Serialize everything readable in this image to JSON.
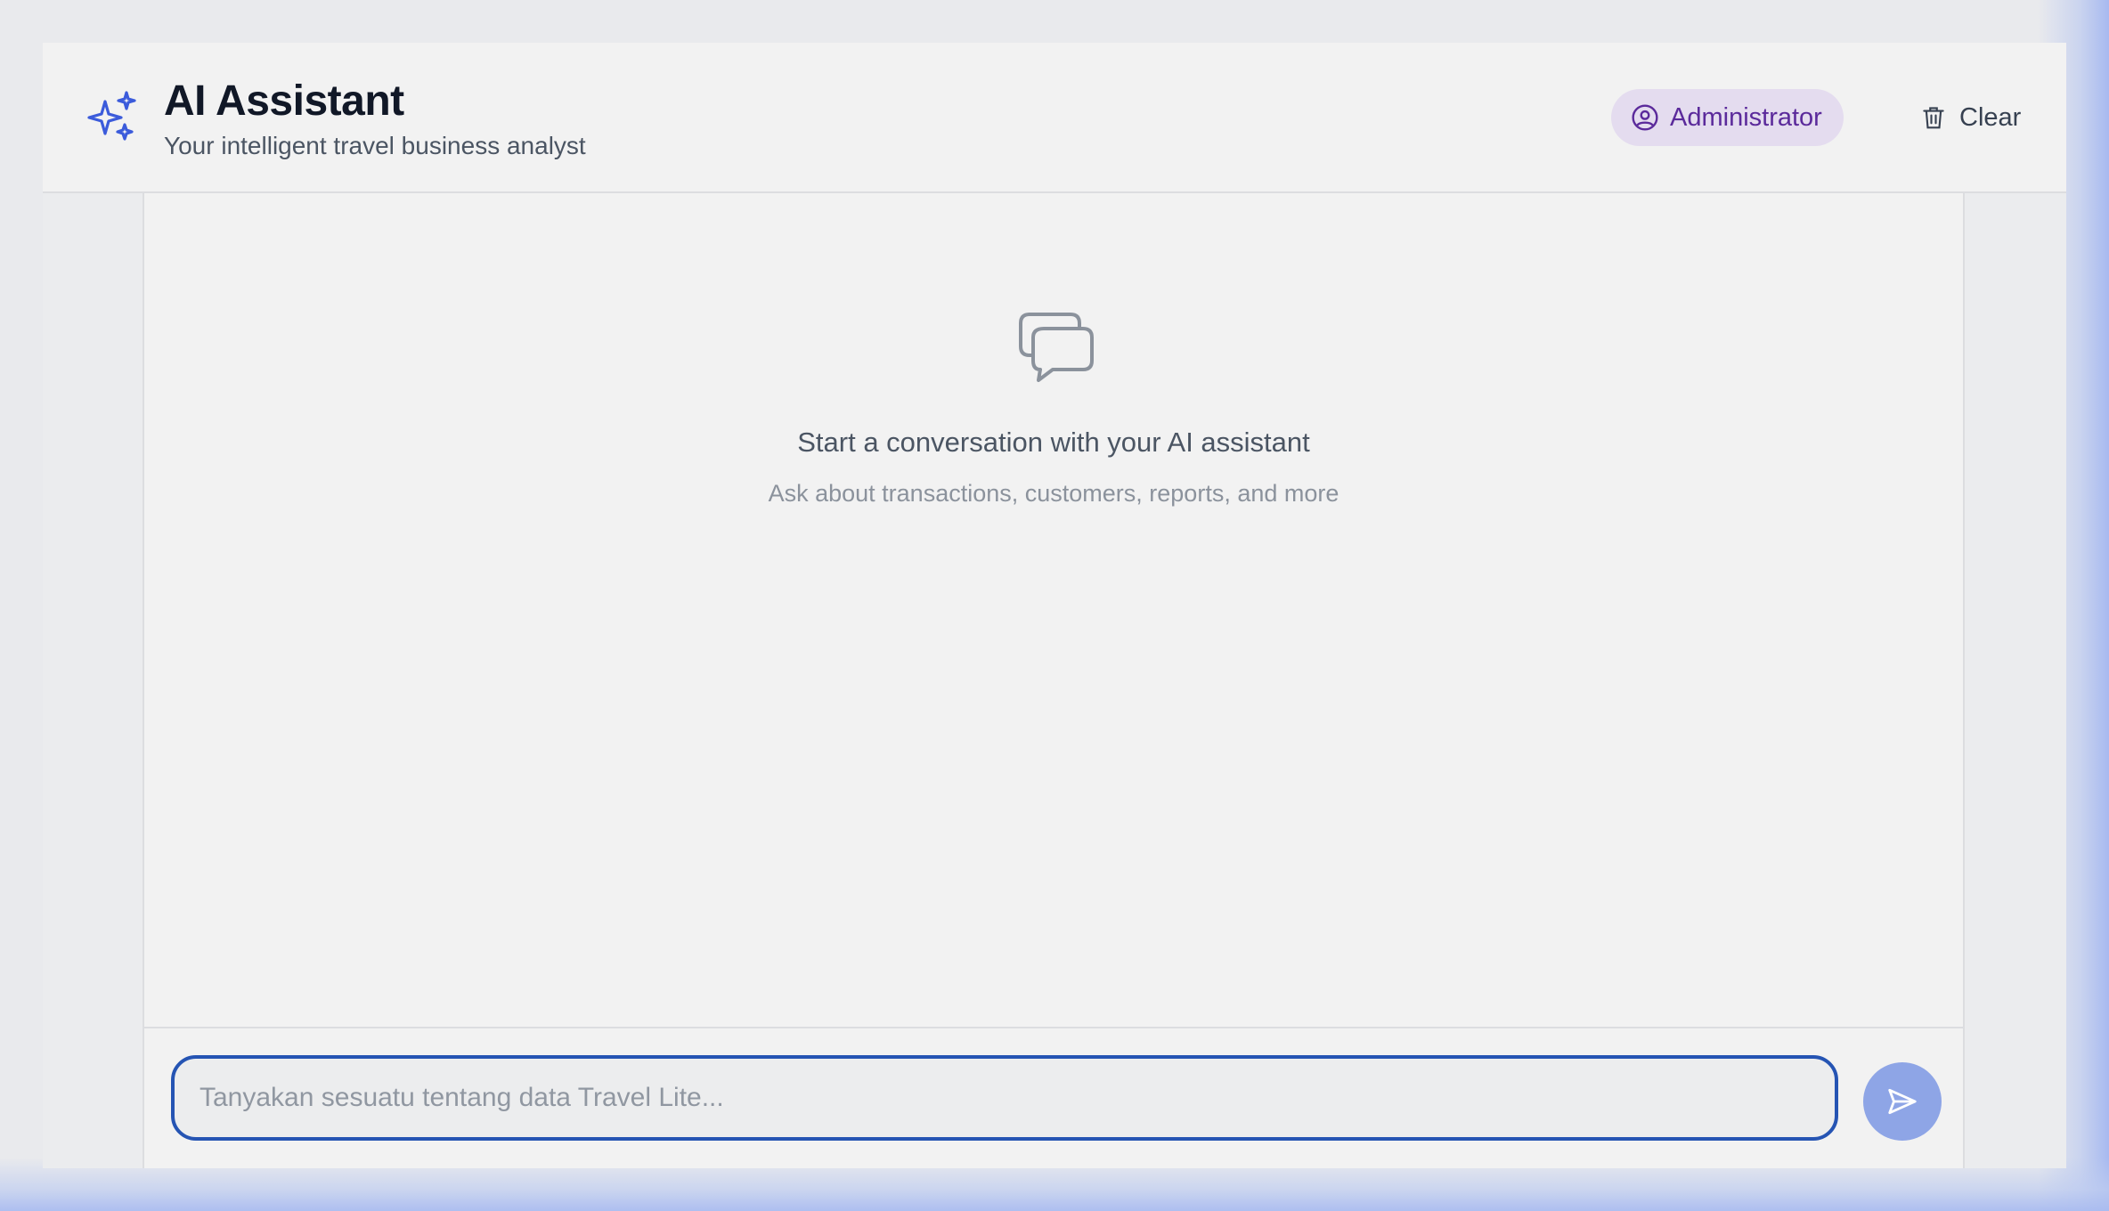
{
  "header": {
    "title": "AI Assistant",
    "subtitle": "Your intelligent travel business analyst",
    "logo_icon": "sparkles-icon",
    "role_badge": {
      "label": "Administrator",
      "icon": "user-circle-icon"
    },
    "clear_button": {
      "label": "Clear",
      "icon": "trash-icon"
    }
  },
  "empty_state": {
    "icon": "chat-bubbles-icon",
    "title": "Start a conversation with your AI assistant",
    "subtitle": "Ask about transactions, customers, reports, and more"
  },
  "composer": {
    "placeholder": "Tanyakan sesuatu tentang data Travel Lite...",
    "value": "",
    "send_icon": "send-icon"
  },
  "colors": {
    "accent": "#3b5bdb",
    "input_border": "#2554b3",
    "send_button": "#8ea5e6",
    "badge_bg": "#e4dcef",
    "badge_text": "#5b2a9b"
  }
}
